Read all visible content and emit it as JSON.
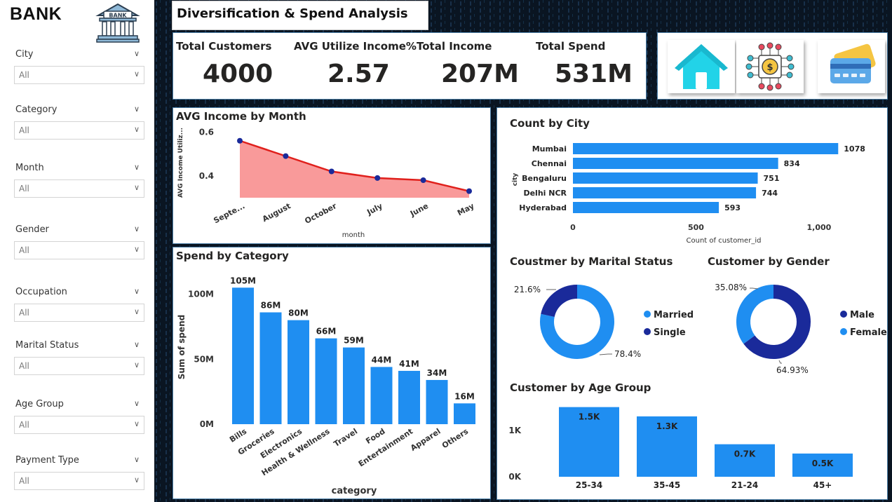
{
  "sidebar": {
    "title": "BANK",
    "logo_text": "BANK",
    "filters": [
      {
        "label": "City",
        "value": "All"
      },
      {
        "label": "Category",
        "value": "All"
      },
      {
        "label": "Month",
        "value": "All"
      },
      {
        "label": "Gender",
        "value": "All"
      },
      {
        "label": "Occupation",
        "value": "All"
      },
      {
        "label": "Marital Status",
        "value": "All"
      },
      {
        "label": "Age Group",
        "value": "All"
      },
      {
        "label": "Payment Type",
        "value": "All"
      }
    ]
  },
  "header": {
    "title": "Diversification & Spend Analysis"
  },
  "kpis": [
    {
      "label": "Total Customers",
      "value": "4000"
    },
    {
      "label": "AVG Utilize Income%",
      "value": "2.57"
    },
    {
      "label": "Total Income",
      "value": "207M"
    },
    {
      "label": "Total Spend",
      "value": "531M"
    }
  ],
  "nav_icons": [
    "home-icon",
    "money-circuit-icon",
    "credit-card-icon"
  ],
  "colors": {
    "bar": "#1f8ef1",
    "dark_blue": "#1a2a9a",
    "area_fill": "#f99a9a",
    "line": "#e0201c"
  },
  "chart_data": [
    {
      "id": "income_by_month",
      "type": "area",
      "title": "AVG Income by Month",
      "xlabel": "month",
      "ylabel": "AVG Income Utiliz...",
      "categories": [
        "Septe...",
        "August",
        "October",
        "July",
        "June",
        "May"
      ],
      "values": [
        0.56,
        0.49,
        0.42,
        0.39,
        0.38,
        0.33
      ],
      "yticks": [
        "0.6",
        "0.4"
      ],
      "ylim": [
        0.3,
        0.62
      ]
    },
    {
      "id": "spend_by_category",
      "type": "bar",
      "title": "Spend by Category",
      "xlabel": "category",
      "ylabel": "Sum of spend",
      "categories": [
        "Bills",
        "Groceries",
        "Electronics",
        "Health & Wellness",
        "Travel",
        "Food",
        "Entertainment",
        "Apparel",
        "Others"
      ],
      "values": [
        105,
        86,
        80,
        66,
        59,
        44,
        41,
        34,
        16
      ],
      "labels": [
        "105M",
        "86M",
        "80M",
        "66M",
        "59M",
        "44M",
        "41M",
        "34M",
        "16M"
      ],
      "yticks": [
        "100M",
        "50M",
        "0M"
      ],
      "ylim": [
        0,
        110
      ]
    },
    {
      "id": "count_by_city",
      "type": "bar",
      "title": "Count by City",
      "xlabel": "Count of customer_id",
      "ylabel": "city",
      "categories": [
        "Mumbai",
        "Chennai",
        "Bengaluru",
        "Delhi NCR",
        "Hyderabad"
      ],
      "values": [
        1078,
        834,
        751,
        744,
        593
      ],
      "labels": [
        "1078",
        "834",
        "751",
        "744",
        "593"
      ],
      "xticks": [
        "0",
        "500",
        "1,000"
      ],
      "xlim": [
        0,
        1100
      ]
    },
    {
      "id": "marital_status",
      "type": "pie",
      "title": "Coustmer by Marital Status",
      "categories": [
        "Married",
        "Single"
      ],
      "values": [
        78.4,
        21.6
      ],
      "labels": [
        "78.4%",
        "21.6%"
      ]
    },
    {
      "id": "gender",
      "type": "pie",
      "title": "Customer by Gender",
      "categories": [
        "Male",
        "Female"
      ],
      "values": [
        64.93,
        35.08
      ],
      "labels": [
        "64.93%",
        "35.08%"
      ]
    },
    {
      "id": "age_group",
      "type": "bar",
      "title": "Customer by Age Group",
      "categories": [
        "25-34",
        "35-45",
        "21-24",
        "45+"
      ],
      "values": [
        1.5,
        1.3,
        0.7,
        0.5
      ],
      "labels": [
        "1.5K",
        "1.3K",
        "0.7K",
        "0.5K"
      ],
      "yticks": [
        "1K",
        "0K"
      ],
      "ylim": [
        0,
        1.6
      ]
    }
  ]
}
